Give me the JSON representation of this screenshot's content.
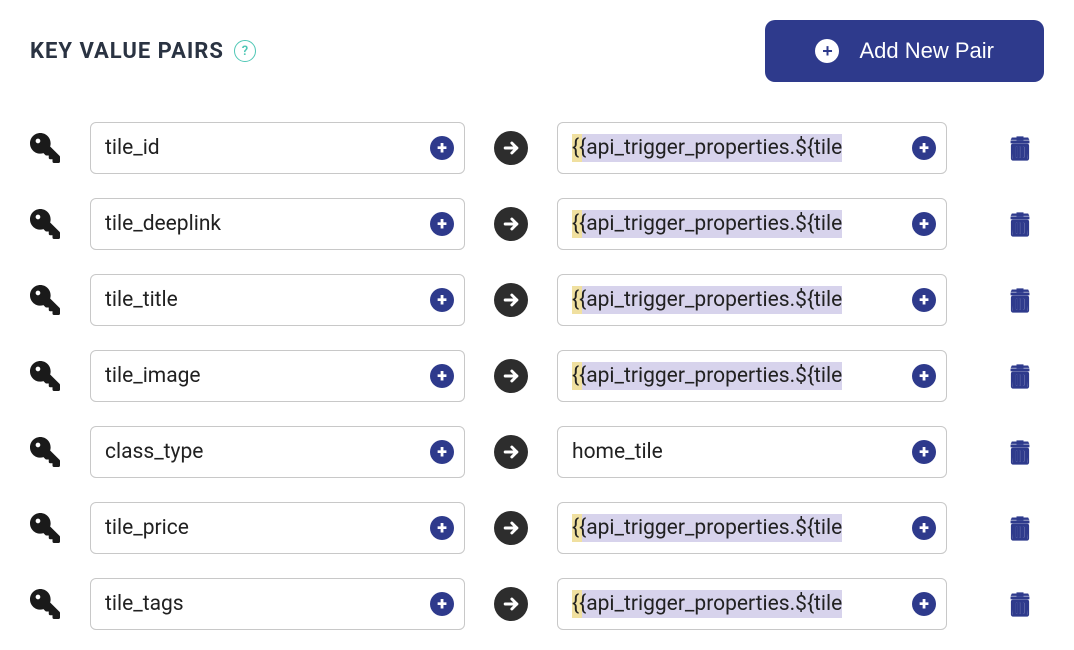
{
  "header": {
    "title": "KEY VALUE PAIRS",
    "help_symbol": "?",
    "add_button_label": "Add New Pair"
  },
  "pairs": [
    {
      "key": "tile_id",
      "value": "{{api_trigger_properties.${tile",
      "value_is_template": true
    },
    {
      "key": "tile_deeplink",
      "value": "{{api_trigger_properties.${tile",
      "value_is_template": true
    },
    {
      "key": "tile_title",
      "value": "{{api_trigger_properties.${tile",
      "value_is_template": true
    },
    {
      "key": "tile_image",
      "value": "{{api_trigger_properties.${tile",
      "value_is_template": true
    },
    {
      "key": "class_type",
      "value": "home_tile",
      "value_is_template": false
    },
    {
      "key": "tile_price",
      "value": "{{api_trigger_properties.${tile",
      "value_is_template": true
    },
    {
      "key": "tile_tags",
      "value": "{{api_trigger_properties.${tile",
      "value_is_template": true
    }
  ]
}
